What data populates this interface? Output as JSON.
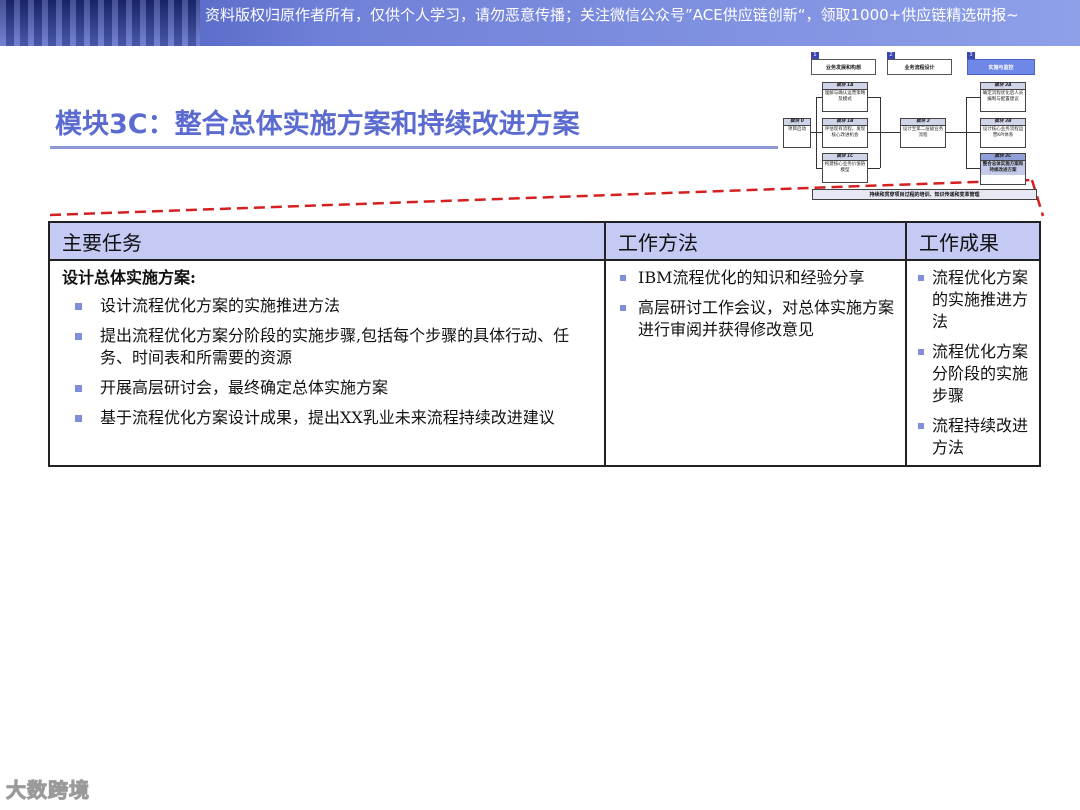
{
  "banner": {
    "text": "资料版权归原作者所有，仅供个人学习，请勿恶意传播；关注微信公众号”ACE供应链创新“，领取1000+供应链精选研报~"
  },
  "title": "模块3C：整合总体实施方案和持续改进方案",
  "mini_diagram": {
    "phases": [
      {
        "num": "1",
        "label": "业务发展和构想"
      },
      {
        "num": "2",
        "label": "业务流程设计"
      },
      {
        "num": "3",
        "label": "实施与监控"
      }
    ],
    "modules": [
      {
        "head": "模块 0",
        "body": "项目启动"
      },
      {
        "head": "模块 1A",
        "body": "理解与确认运营策略及模式"
      },
      {
        "head": "模块 1B",
        "body": "评估现有流程，发现核心改进机会"
      },
      {
        "head": "模块 1C",
        "body": "构建核心业务价值链模型"
      },
      {
        "head": "模块 2",
        "body": "设计至第二层级业务流程"
      },
      {
        "head": "模块 3A",
        "body": "确定流程优化后人员编制与配置建议"
      },
      {
        "head": "模块 3B",
        "body": "设计核心业务流程运营KPI体系"
      },
      {
        "head": "模块 3C",
        "body": "整合总体实施方案和持续改进方案"
      }
    ],
    "footer": "持续和贯穿项目过程的培训、知识传递和变革管理"
  },
  "table": {
    "headers": [
      "主要任务",
      "工作方法",
      "工作成果"
    ],
    "tasks": {
      "subtitle": "设计总体实施方案:",
      "items": [
        "设计流程优化方案的实施推进方法",
        "提出流程优化方案分阶段的实施步骤,包括每个步骤的具体行动、任务、时间表和所需要的资源",
        "开展高层研讨会，最终确定总体实施方案",
        "基于流程优化方案设计成果，提出XX乳业未来流程持续改进建议"
      ]
    },
    "methods": [
      "IBM流程优化的知识和经验分享",
      "高层研讨工作会议，对总体实施方案进行审阅并获得修改意见"
    ],
    "results": [
      "流程优化方案的实施推进方法",
      "流程优化方案分阶段的实施步骤",
      "流程持续改进方法"
    ]
  },
  "logo": "大数跨境",
  "colors": {
    "accent": "#5b6bd0",
    "header_fill": "#c5caf4",
    "bullet": "#7f8fd9",
    "dash": "#d42020"
  }
}
